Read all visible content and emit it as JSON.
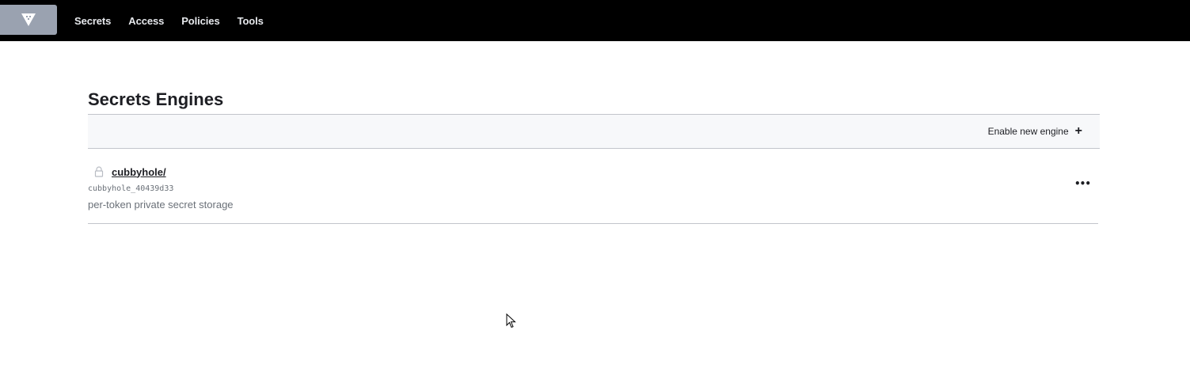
{
  "topbar": {
    "logo": {
      "icon": "vault-triangle-icon",
      "bg": "#9aa2b0"
    },
    "nav": [
      {
        "label": "Secrets"
      },
      {
        "label": "Access"
      },
      {
        "label": "Policies"
      },
      {
        "label": "Tools"
      }
    ]
  },
  "main": {
    "title": "Secrets Engines",
    "toolbar": {
      "enable_label": "Enable new engine",
      "enable_icon": "plus-icon"
    },
    "engines": [
      {
        "icon": "lock-icon",
        "path": "cubbyhole/",
        "accessor": "cubbyhole_40439d33",
        "description": "per-token private secret storage",
        "menu_icon": "more-options-icon"
      }
    ]
  },
  "colors": {
    "topbar_bg": "#000000",
    "toolbar_bg": "#f7f8fa",
    "border": "#c2c5cb",
    "text": "#1d1e23",
    "muted": "#6a7078"
  }
}
